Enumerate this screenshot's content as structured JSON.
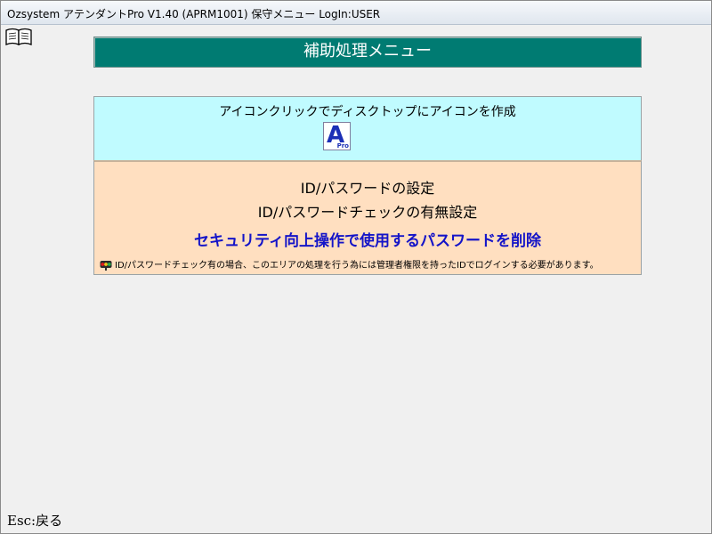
{
  "window": {
    "title": "Ozsystem アテンダントPro V1.40 (APRM1001) 保守メニュー LogIn:USER"
  },
  "icons": {
    "manual": "open-book-icon",
    "app": "attendant-pro-app-icon",
    "note": "traffic-signal-icon"
  },
  "header": {
    "title": "補助処理メニュー"
  },
  "shortcut_panel": {
    "caption": "アイコンクリックでディスクトップにアイコンを作成",
    "icon_letter": "A",
    "icon_sub": "Pro"
  },
  "settings_panel": {
    "password_setting": "ID/パスワードの設定",
    "password_check_setting": "ID/パスワードチェックの有無設定",
    "delete_password": "セキュリティ向上操作で使用するパスワードを削除",
    "note": "ID/パスワードチェック有の場合、このエリアの処理を行う為には管理者権限を持ったIDでログインする必要があります。"
  },
  "footer": {
    "esc_label": "Esc:戻る"
  },
  "colors": {
    "header_bg": "#007b72",
    "shortcut_bg": "#c0fbff",
    "settings_bg": "#ffdfc0",
    "accent_text": "#1414c8"
  }
}
